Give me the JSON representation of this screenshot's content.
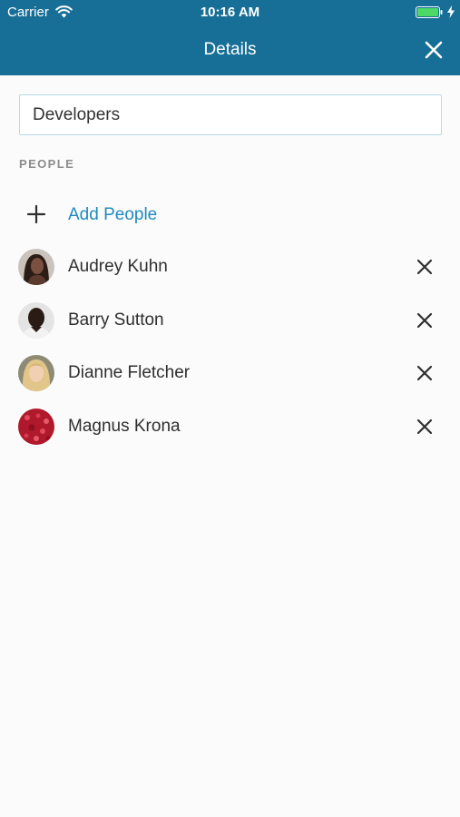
{
  "status_bar": {
    "carrier": "Carrier",
    "time": "10:16 AM"
  },
  "header": {
    "title": "Details"
  },
  "group_name": {
    "value": "Developers"
  },
  "people_section": {
    "heading": "PEOPLE",
    "add_label": "Add People",
    "members": [
      {
        "name": "Audrey Kuhn",
        "avatar_color": "#3b2a22"
      },
      {
        "name": "Barry Sutton",
        "avatar_color": "#2a1d17"
      },
      {
        "name": "Dianne Fletcher",
        "avatar_color": "#d9b985"
      },
      {
        "name": "Magnus Krona",
        "avatar_color": "#b0182b"
      }
    ]
  },
  "colors": {
    "header_bg": "#176f97",
    "accent": "#1e8bbf",
    "battery": "#4cd964"
  }
}
